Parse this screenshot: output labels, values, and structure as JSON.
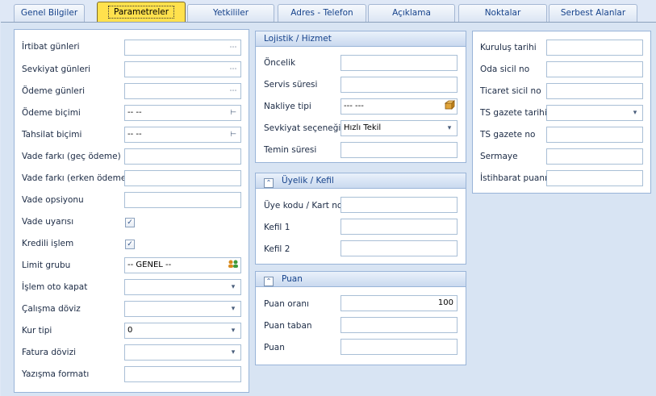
{
  "tabs": [
    {
      "label": "Genel Bilgiler"
    },
    {
      "label": "Parametreler"
    },
    {
      "label": "Yetkililer"
    },
    {
      "label": "Adres - Telefon"
    },
    {
      "label": "Açıklama"
    },
    {
      "label": "Noktalar"
    },
    {
      "label": "Serbest Alanlar"
    }
  ],
  "left": {
    "irtibat": {
      "label": "İrtibat günleri",
      "value": ""
    },
    "sevkiyat_gunleri": {
      "label": "Sevkiyat günleri",
      "value": ""
    },
    "odeme_gunleri": {
      "label": "Ödeme günleri",
      "value": ""
    },
    "odeme_bicimi": {
      "label": "Ödeme biçimi",
      "value": "-- --"
    },
    "tahsilat_bicimi": {
      "label": "Tahsilat biçimi",
      "value": "-- --"
    },
    "vade_gec": {
      "label": "Vade farkı (geç ödeme)",
      "value": ""
    },
    "vade_erken": {
      "label": "Vade farkı (erken ödeme)",
      "value": ""
    },
    "vade_opsiyonu": {
      "label": "Vade opsiyonu",
      "value": ""
    },
    "vade_uyarisi": {
      "label": "Vade uyarısı",
      "checked": true
    },
    "kredili_islem": {
      "label": "Kredili işlem",
      "checked": true
    },
    "limit_grubu": {
      "label": "Limit grubu",
      "value": "-- GENEL --"
    },
    "islem_oto_kapat": {
      "label": "İşlem oto kapat",
      "value": ""
    },
    "calisma_doviz": {
      "label": "Çalışma döviz",
      "value": ""
    },
    "kur_tipi": {
      "label": "Kur tipi",
      "value": "0"
    },
    "fatura_dovizi": {
      "label": "Fatura dövizi",
      "value": ""
    },
    "yazisma_formati": {
      "label": "Yazışma formatı",
      "value": ""
    }
  },
  "lojistik": {
    "title": "Lojistik / Hizmet",
    "oncelik": {
      "label": "Öncelik",
      "value": ""
    },
    "servis_suresi": {
      "label": "Servis süresi",
      "value": ""
    },
    "nakliye_tipi": {
      "label": "Nakliye tipi",
      "value": "--- ---"
    },
    "sevkiyat_secenegi": {
      "label": "Sevkiyat seçeneği",
      "value": "Hızlı Tekil"
    },
    "temin_suresi": {
      "label": "Temin süresi",
      "value": ""
    }
  },
  "uyelik": {
    "title": "Üyelik / Kefil",
    "uye_kodu": {
      "label": "Üye kodu / Kart no",
      "value": ""
    },
    "kefil1": {
      "label": "Kefil 1",
      "value": ""
    },
    "kefil2": {
      "label": "Kefil 2",
      "value": ""
    }
  },
  "puan": {
    "title": "Puan",
    "puan_orani": {
      "label": "Puan oranı",
      "value": "100"
    },
    "puan_taban": {
      "label": "Puan taban",
      "value": ""
    },
    "puan": {
      "label": "Puan",
      "value": ""
    }
  },
  "right": {
    "kurulus_tarihi": {
      "label": "Kuruluş tarihi",
      "value": ""
    },
    "oda_sicil": {
      "label": "Oda sicil no",
      "value": ""
    },
    "ticaret_sicil": {
      "label": "Ticaret sicil no",
      "value": ""
    },
    "ts_gazete_tarihi": {
      "label": "TS gazete tarihi",
      "value": ""
    },
    "ts_gazete_no": {
      "label": "TS gazete no",
      "value": ""
    },
    "sermaye": {
      "label": "Sermaye",
      "value": ""
    },
    "istihbarat": {
      "label": "İstihbarat puanı",
      "value": ""
    }
  },
  "icons": {
    "ellipsis": "⋯",
    "tree": "⊢",
    "dropdown": "▾",
    "check": "✓",
    "collapse": "⌃"
  },
  "colors": {
    "active_tab": "#ffe14d",
    "panel_border": "#99b4d8",
    "header_text": "#15428b"
  }
}
